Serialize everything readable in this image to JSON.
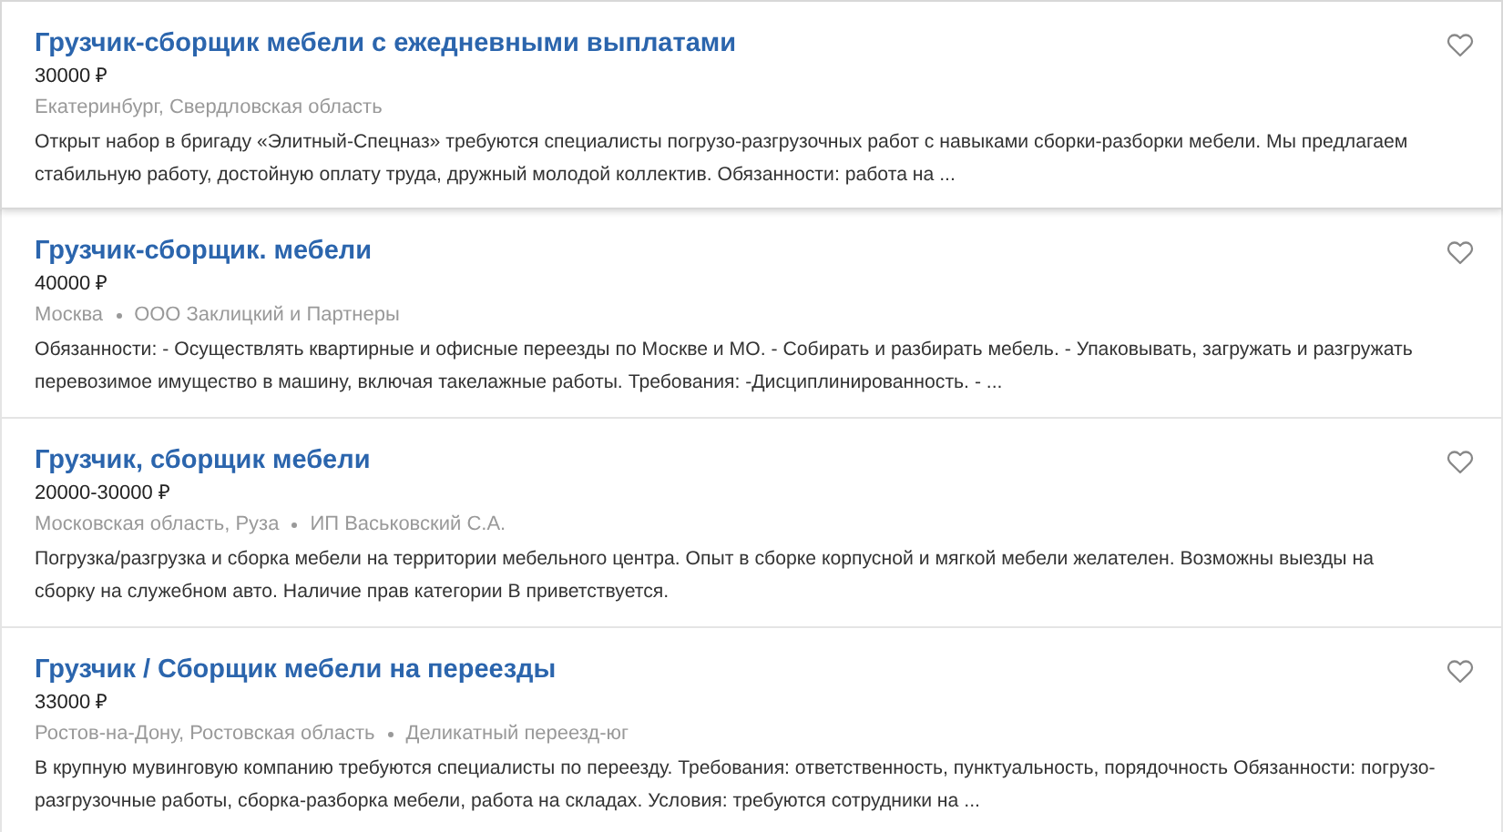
{
  "vacancies": [
    {
      "title": "Грузчик-сборщик мебели с ежедневными выплатами",
      "salary": "30000 ₽",
      "location": "Екатеринбург, Свердловская область",
      "description": "Открыт набор в бригаду «Элитный-Спецназ» требуются специалисты погрузо-разгрузочных работ с навыками сборки-разборки мебели. Мы предлагаем стабильную работу, достойную оплату труда, дружный молодой коллектив. Обязанности: работа на ...",
      "selected": true
    },
    {
      "title": "Грузчик-сборщик. мебели",
      "salary": "40000 ₽",
      "location": "Москва",
      "company": "ООО Заклицкий и Партнеры",
      "description": "Обязанности: - Осуществлять квартирные и офисные переезды по Москве и МО. - Собирать и разбирать мебель. - Упаковывать, загружать и разгружать перевозимое имущество в машину, включая такелажные работы. Требования: -Дисциплинированность. - ...",
      "selected": false
    },
    {
      "title": "Грузчик, сборщик мебели",
      "salary": "20000-30000 ₽",
      "location": "Московская область, Руза",
      "company": "ИП Васьковский С.А.",
      "description": "Погрузка/разгрузка и сборка мебели на территории мебельного центра. Опыт в сборке корпусной и мягкой мебели желателен. Возможны выезды на сборку на служебном авто. Наличие прав категории В приветствуется.",
      "selected": false
    },
    {
      "title": "Грузчик / Сборщик мебели на переезды",
      "salary": "33000 ₽",
      "location": "Ростов-на-Дону, Ростовская область",
      "company": "Деликатный переезд-юг",
      "description": "В крупную мувинговую компанию требуются специалисты по переезду. Требования: ответственность, пунктуальность, порядочность Обязанности: погрузо-разгрузочные работы, сборка-разборка мебели, работа на складах. Условия: требуются сотрудники на ...",
      "selected": false
    }
  ]
}
